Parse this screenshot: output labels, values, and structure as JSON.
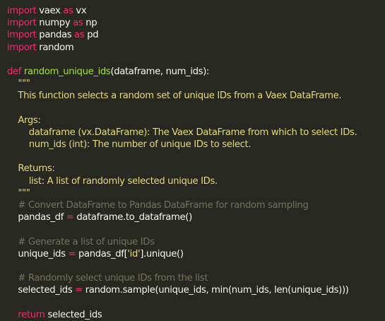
{
  "colors": {
    "background": "#272822",
    "keyword": "#f92672",
    "function": "#a6e22e",
    "string": "#e6db74",
    "comment": "#75715e",
    "plain": "#f8f8f2"
  },
  "code": {
    "lines": [
      [
        {
          "t": "kw",
          "v": "import"
        },
        {
          "t": "pl",
          "v": " vaex "
        },
        {
          "t": "kw",
          "v": "as"
        },
        {
          "t": "pl",
          "v": " vx"
        }
      ],
      [
        {
          "t": "kw",
          "v": "import"
        },
        {
          "t": "pl",
          "v": " numpy "
        },
        {
          "t": "kw",
          "v": "as"
        },
        {
          "t": "pl",
          "v": " np"
        }
      ],
      [
        {
          "t": "kw",
          "v": "import"
        },
        {
          "t": "pl",
          "v": " pandas "
        },
        {
          "t": "kw",
          "v": "as"
        },
        {
          "t": "pl",
          "v": " pd"
        }
      ],
      [
        {
          "t": "kw",
          "v": "import"
        },
        {
          "t": "pl",
          "v": " random"
        }
      ],
      [],
      [
        {
          "t": "kw",
          "v": "def"
        },
        {
          "t": "pl",
          "v": " "
        },
        {
          "t": "fn",
          "v": "random_unique_ids"
        },
        {
          "t": "pl",
          "v": "(dataframe, num_ids):"
        }
      ],
      [
        {
          "t": "str",
          "v": "    \"\"\""
        }
      ],
      [
        {
          "t": "str",
          "v": "    This function selects a random set of unique IDs from a Vaex DataFrame."
        }
      ],
      [],
      [
        {
          "t": "str",
          "v": "    Args:"
        }
      ],
      [
        {
          "t": "str",
          "v": "        dataframe (vx.DataFrame): The Vaex DataFrame from which to select IDs."
        }
      ],
      [
        {
          "t": "str",
          "v": "        num_ids (int): The number of unique IDs to select."
        }
      ],
      [],
      [
        {
          "t": "str",
          "v": "    Returns:"
        }
      ],
      [
        {
          "t": "str",
          "v": "        list: A list of randomly selected unique IDs."
        }
      ],
      [
        {
          "t": "str",
          "v": "    \"\"\""
        }
      ],
      [
        {
          "t": "cmt",
          "v": "    # Convert DataFrame to Pandas DataFrame for random sampling"
        }
      ],
      [
        {
          "t": "pl",
          "v": "    pandas_df "
        },
        {
          "t": "kw",
          "v": "="
        },
        {
          "t": "pl",
          "v": " dataframe.to_dataframe()"
        }
      ],
      [],
      [
        {
          "t": "cmt",
          "v": "    # Generate a list of unique IDs"
        }
      ],
      [
        {
          "t": "pl",
          "v": "    unique_ids "
        },
        {
          "t": "kw",
          "v": "="
        },
        {
          "t": "pl",
          "v": " pandas_df["
        },
        {
          "t": "str",
          "v": "'id'"
        },
        {
          "t": "pl",
          "v": "].unique()"
        }
      ],
      [],
      [
        {
          "t": "cmt",
          "v": "    # Randomly select unique IDs from the list"
        }
      ],
      [
        {
          "t": "pl",
          "v": "    selected_ids "
        },
        {
          "t": "kw",
          "v": "="
        },
        {
          "t": "pl",
          "v": " random.sample(unique_ids, min(num_ids, len(unique_ids)))"
        }
      ],
      [],
      [
        {
          "t": "pl",
          "v": "    "
        },
        {
          "t": "kw",
          "v": "return"
        },
        {
          "t": "pl",
          "v": " selected_ids"
        }
      ]
    ]
  }
}
